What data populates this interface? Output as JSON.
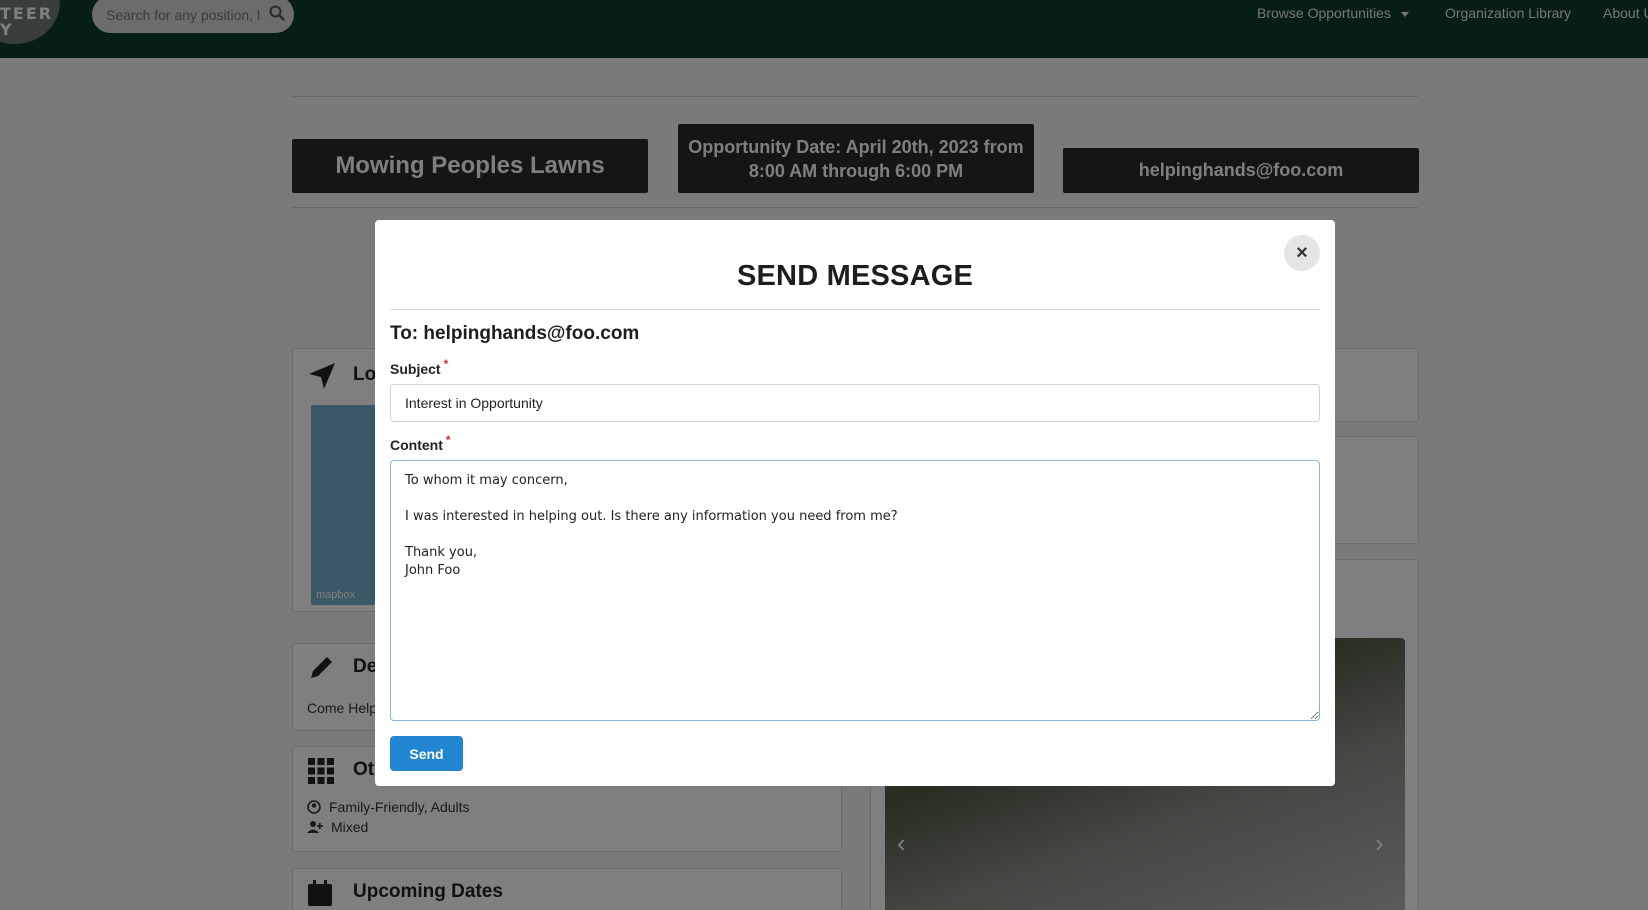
{
  "nav": {
    "logo_line1": "TEER",
    "logo_line2": "Y",
    "search_placeholder": "Search for any position, l",
    "browse_label": "Browse Opportunities",
    "library_label": "Organization Library",
    "about_label": "About U"
  },
  "opportunity": {
    "title": "Mowing Peoples Lawns",
    "date_line": "Opportunity Date: April 20th, 2023 from 8:00 AM through 6:00 PM",
    "email": "helpinghands@foo.com"
  },
  "cards": {
    "location_title": "Loc",
    "map_attribution": "mapbox",
    "description_title": "De",
    "description_text": "Come Help",
    "other_title": "Ot",
    "other_age": "Family-Friendly, Adults",
    "other_gender": "Mixed",
    "dates_title": "Upcoming Dates"
  },
  "carousel": {
    "prev": "‹",
    "next": "›"
  },
  "modal": {
    "title": "SEND MESSAGE",
    "close_symbol": "×",
    "to_line": "To: helpinghands@foo.com",
    "subject_label": "Subject",
    "subject_value": "Interest in Opportunity",
    "content_label": "Content",
    "content_value": "To whom it may concern,\n\nI was interested in helping out. Is there any information you need from me?\n\nThank you,\nJohn Foo",
    "required_marker": "*",
    "send_label": "Send"
  },
  "colors": {
    "nav_bg": "#0f3d2e",
    "header_box_bg": "#2b2b2b",
    "send_button": "#2185d0",
    "required": "#db2828",
    "overlay": "rgba(0,0,0,0.5)"
  }
}
